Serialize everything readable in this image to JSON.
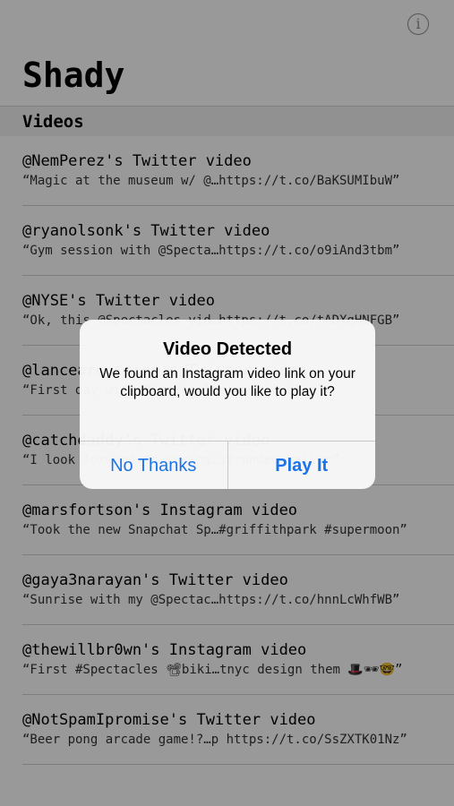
{
  "header": {
    "title": "Shady",
    "info_icon": "info-icon",
    "info_glyph": "i"
  },
  "section": {
    "title": "Videos"
  },
  "videos": [
    {
      "title": "@NemPerez's Twitter video",
      "caption": "“Magic at the museum w/ @…https://t.co/BaKSUMIbuW”"
    },
    {
      "title": "@ryanolsonk's Twitter video",
      "caption": "“Gym session with @Specta…https://t.co/o9iAnd3tbm”"
    },
    {
      "title": "@NYSE's Twitter video",
      "caption": "“Ok, this @Spectacles vid…https://t.co/tADXgHNFGB”"
    },
    {
      "title": "@lancearmstrong's Twitter video",
      "caption": "“First day with @Spectacles on the bike”"
    },
    {
      "title": "@catchdaddy's Twitter video",
      "caption": "“I look forward to seeing…stranded baller”"
    },
    {
      "title": "@marsfortson's Instagram video",
      "caption": "“Took the new Snapchat Sp…#griffithpark #supermoon”"
    },
    {
      "title": "@gaya3narayan's Twitter video",
      "caption": "“Sunrise with my @Spectac…https://t.co/hnnLcWhfWB”"
    },
    {
      "title": "@thewillbr0wn's Instagram video",
      "caption": "“First #Spectacles 📽biki…tnyc design them 🎩🕶🤓”"
    },
    {
      "title": "@NotSpamIpromise's Twitter video",
      "caption": "“Beer pong arcade game!?…p https://t.co/SsZXTK01Nz”"
    }
  ],
  "alert": {
    "title": "Video Detected",
    "message": "We found an Instagram video link on your clipboard, would you like to play it?",
    "cancel_label": "No Thanks",
    "confirm_label": "Play It",
    "button_color": "#1a73e8"
  }
}
